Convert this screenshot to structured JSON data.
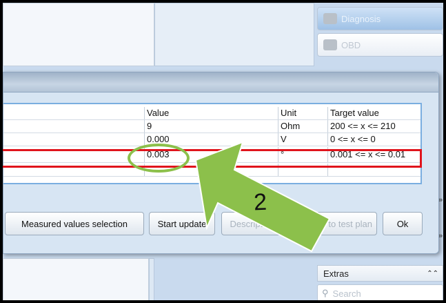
{
  "sidebar": {
    "buttons": [
      {
        "label": "Diagnosis",
        "state": "active"
      },
      {
        "label": "OBD",
        "state": "inactive"
      }
    ],
    "extras": {
      "label": "Extras"
    },
    "search": {
      "placeholder": "Search"
    }
  },
  "dialog": {
    "table": {
      "columns": [
        "Value",
        "Unit",
        "Target value"
      ],
      "rows": [
        {
          "value": "9",
          "unit": "Ohm",
          "target": "200 <= x <= 210"
        },
        {
          "value": "0.000",
          "unit": "V",
          "target": "0 <= x <= 0"
        },
        {
          "value": "0.003",
          "unit": "°",
          "target": "0.001 <= x <= 0.01"
        },
        {
          "value": "",
          "unit": "",
          "target": ""
        }
      ]
    },
    "buttons": {
      "measured": "Measured values selection",
      "start_update": "Start update",
      "description": "Description",
      "test_plan": "to test plan",
      "ok": "Ok"
    }
  },
  "annotation": {
    "step_number": "2",
    "highlight_color": "#e0141c",
    "arrow_color": "#8cc04b"
  }
}
